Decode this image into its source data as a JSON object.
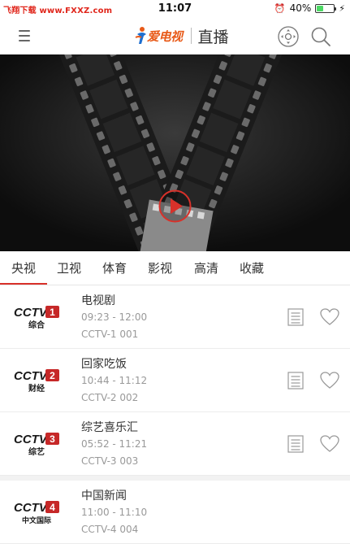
{
  "status_bar": {
    "watermark": "飞翔下载 www.FXXZ.com",
    "time": "11:07",
    "battery": "40%",
    "battery_level": 0.4
  },
  "nav": {
    "brand": "爱电视",
    "page_title": "直播"
  },
  "colors": {
    "accent": "#d8312a",
    "brand_orange": "#e85a18"
  },
  "tabs": [
    {
      "label": "央视",
      "active": true
    },
    {
      "label": "卫视",
      "active": false
    },
    {
      "label": "体育",
      "active": false
    },
    {
      "label": "影视",
      "active": false
    },
    {
      "label": "高清",
      "active": false
    },
    {
      "label": "收藏",
      "active": false
    }
  ],
  "channels": [
    {
      "logo_num": "1",
      "logo_sub": "综合",
      "program": "电视剧",
      "time": "09:23 - 12:00",
      "code": "CCTV-1 001",
      "icons": [
        "guide-icon",
        "heart-icon"
      ]
    },
    {
      "logo_num": "2",
      "logo_sub": "财经",
      "program": "回家吃饭",
      "time": "10:44 - 11:12",
      "code": "CCTV-2 002",
      "icons": [
        "guide-icon",
        "heart-icon"
      ]
    },
    {
      "logo_num": "3",
      "logo_sub": "综艺",
      "program": "综艺喜乐汇",
      "time": "05:52 - 11:21",
      "code": "CCTV-3 003",
      "icons": [
        "guide-icon",
        "heart-icon"
      ]
    },
    {
      "logo_num": "4",
      "logo_sub": "中文国际",
      "program": "中国新闻",
      "time": "11:00 - 11:10",
      "code": "CCTV-4 004",
      "icons": []
    }
  ],
  "logo_text": "CCTV"
}
